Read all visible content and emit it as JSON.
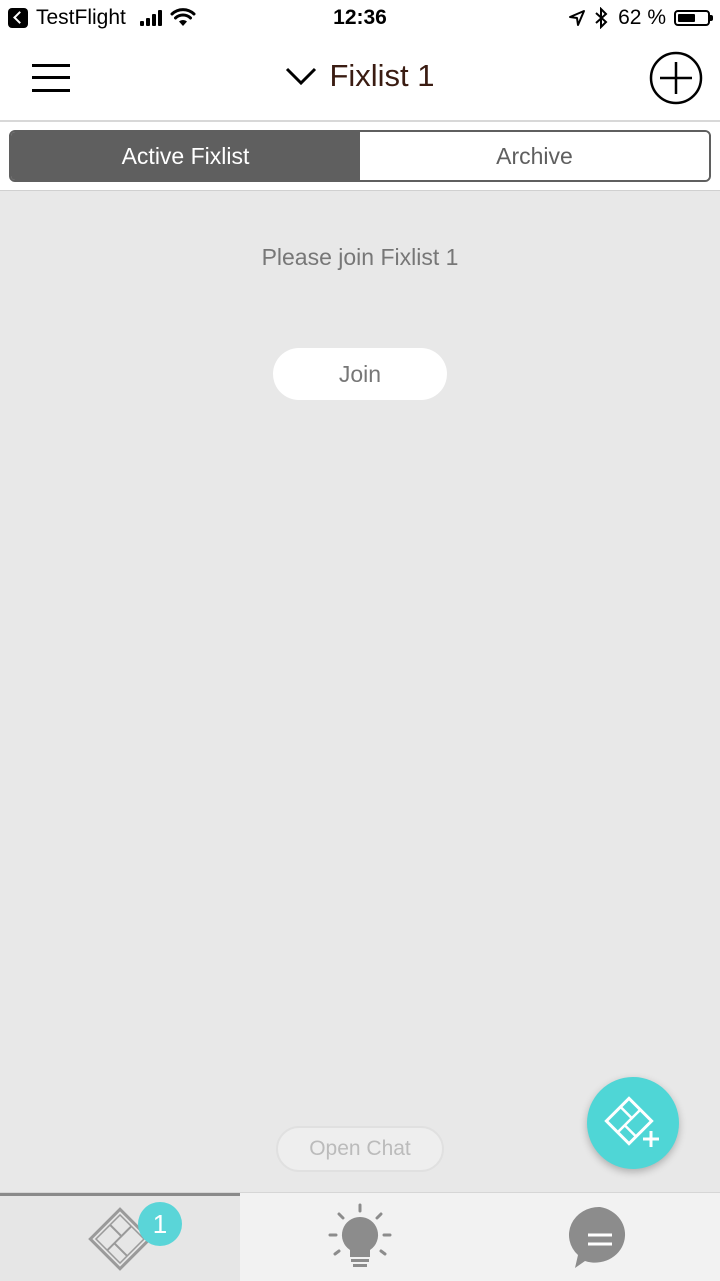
{
  "status_bar": {
    "back_app": "TestFlight",
    "time": "12:36",
    "battery_percent_text": "62 %",
    "battery_level": 0.62
  },
  "header": {
    "title": "Fixlist 1",
    "menu_icon": "hamburger-menu-icon",
    "add_icon": "plus-circle-icon",
    "dropdown_icon": "chevron-down-icon"
  },
  "segments": {
    "active_label": "Active Fixlist",
    "archive_label": "Archive"
  },
  "content": {
    "prompt": "Please join Fixlist 1",
    "join_label": "Join",
    "open_chat_label": "Open Chat"
  },
  "tab_bar": {
    "badge_count": "1",
    "tabs": [
      "fixlist-tab",
      "ideas-tab",
      "chat-tab"
    ]
  },
  "colors": {
    "accent_teal": "#4fd6d6",
    "segment_dark": "#5f5f5f",
    "title_brown": "#3a1c12"
  }
}
